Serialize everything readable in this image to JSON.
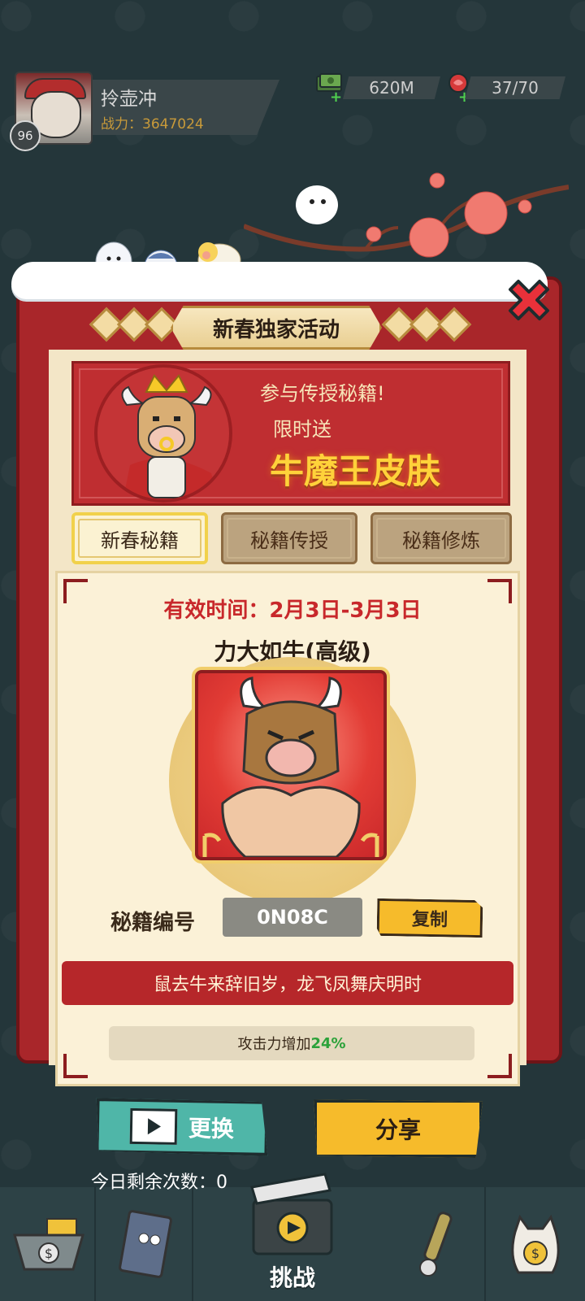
{
  "player": {
    "name": "拎壶冲",
    "level": "96",
    "power_label": "战力：3647024"
  },
  "resources": {
    "money": "620M",
    "stamina": "37/70"
  },
  "modal": {
    "title": "新春独家活动",
    "banner": {
      "line1": "参与传授秘籍!",
      "line2": "限时送",
      "highlight": "牛魔王皮肤"
    },
    "tabs": [
      {
        "label": "新春秘籍",
        "active": true
      },
      {
        "label": "秘籍传授",
        "active": false
      },
      {
        "label": "秘籍修炼",
        "active": false
      }
    ],
    "content": {
      "validity": "有效时间：2月3日-3月3日",
      "skill_name": "力大如牛(高级)",
      "code_label": "秘籍编号",
      "code_value": "0N08C",
      "copy_label": "复制",
      "motto": "鼠去牛来辞旧岁，龙飞凤舞庆明时",
      "bonus_prefix": "攻击力增加",
      "bonus_value": "24%"
    },
    "change_label": "更换",
    "share_label": "分享",
    "remaining_label": "今日剩余次数：0"
  },
  "bottom_nav": {
    "center_label": "挑战",
    "items": [
      "shop-cart-icon",
      "notebook-icon",
      "clapper-icon",
      "scroll-icon",
      "lucky-cat-icon"
    ]
  },
  "colors": {
    "background": "#24363a",
    "frame_red": "#a9262a",
    "gold": "#f6bb2b",
    "teal": "#4fb6a8",
    "bonus_green": "#2ca23a"
  }
}
